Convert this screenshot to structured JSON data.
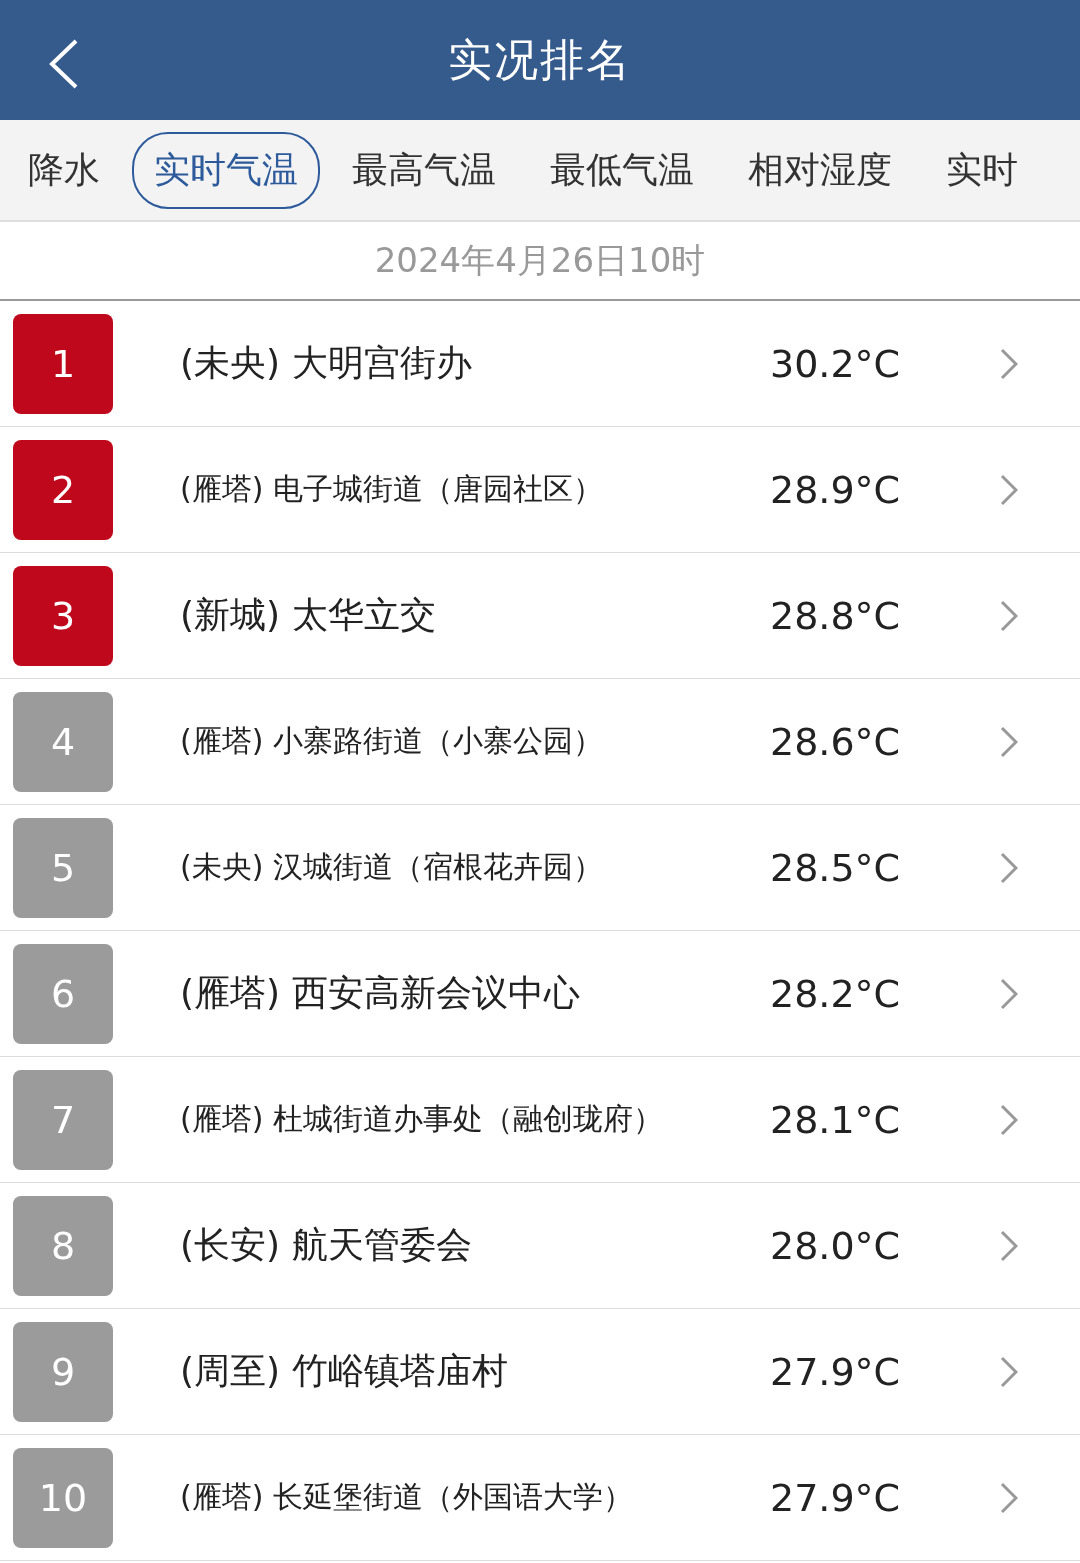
{
  "header": {
    "title": "实况排名"
  },
  "tabs": [
    {
      "label": "降水",
      "selected": false
    },
    {
      "label": "实时气温",
      "selected": true
    },
    {
      "label": "最高气温",
      "selected": false
    },
    {
      "label": "最低气温",
      "selected": false
    },
    {
      "label": "相对湿度",
      "selected": false
    },
    {
      "label": "实时",
      "selected": false
    }
  ],
  "date": "2024年4月26日10时",
  "rows": [
    {
      "rank": "1",
      "name": "(未央) 大明宫街办",
      "value": "30.2°C",
      "highlight": true
    },
    {
      "rank": "2",
      "name": "(雁塔) 电子城街道（唐园社区）",
      "value": "28.9°C",
      "highlight": true
    },
    {
      "rank": "3",
      "name": "(新城) 太华立交",
      "value": "28.8°C",
      "highlight": true
    },
    {
      "rank": "4",
      "name": "(雁塔) 小寨路街道（小寨公园）",
      "value": "28.6°C",
      "highlight": false
    },
    {
      "rank": "5",
      "name": "(未央) 汉城街道（宿根花卉园）",
      "value": "28.5°C",
      "highlight": false
    },
    {
      "rank": "6",
      "name": "(雁塔) 西安高新会议中心",
      "value": "28.2°C",
      "highlight": false
    },
    {
      "rank": "7",
      "name": "(雁塔) 杜城街道办事处（融创珑府）",
      "value": "28.1°C",
      "highlight": false
    },
    {
      "rank": "8",
      "name": "(长安) 航天管委会",
      "value": "28.0°C",
      "highlight": false
    },
    {
      "rank": "9",
      "name": "(周至) 竹峪镇塔庙村",
      "value": "27.9°C",
      "highlight": false
    },
    {
      "rank": "10",
      "name": "(雁塔) 长延堡街道（外国语大学）",
      "value": "27.9°C",
      "highlight": false
    }
  ]
}
